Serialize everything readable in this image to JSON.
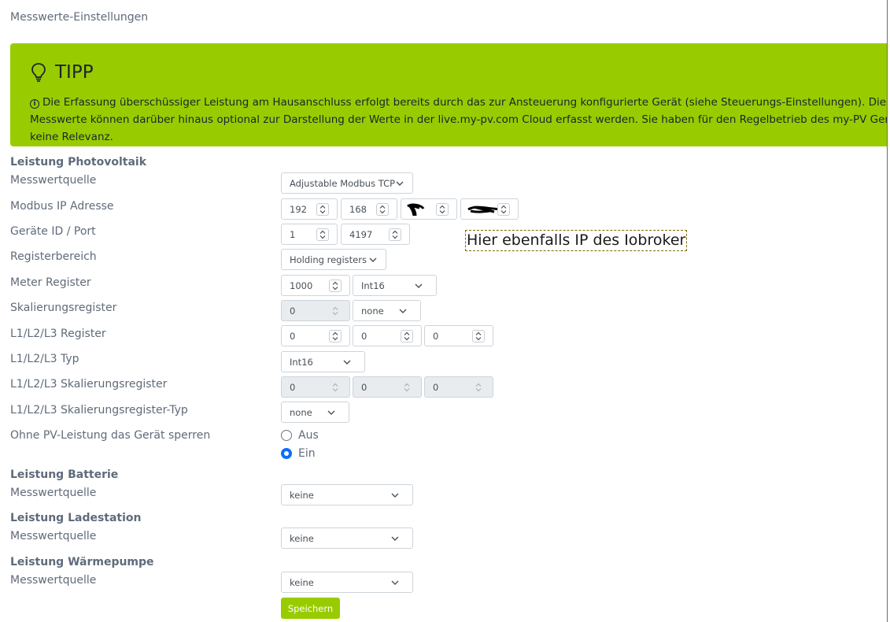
{
  "page": {
    "title": "Messwerte-Einstellungen"
  },
  "tipp": {
    "title": "TIPP",
    "text": "Die Erfassung überschüssiger Leistung am Hausanschluss erfolgt bereits durch das zur Ansteuerung konfigurierte Gerät (siehe Steuerungs-Einstellungen). Diese Messwerte können darüber hinaus optional zur Darstellung der Werte in der live.my-pv.com Cloud erfasst werden. Sie haben für den Regelbetrieb des my-PV Geräts keine Relevanz."
  },
  "pv": {
    "section": "Leistung Photovoltaik",
    "source_label": "Messwertquelle",
    "source_value": "Adjustable Modbus TCP",
    "ip_label": "Modbus IP Adresse",
    "ip": [
      "192",
      "168",
      "",
      ""
    ],
    "id_port_label": "Geräte ID / Port",
    "device_id": "1",
    "port": "4197",
    "register_area_label": "Registerbereich",
    "register_area_value": "Holding registers",
    "meter_register_label": "Meter Register",
    "meter_register_value": "1000",
    "meter_register_type": "Int16",
    "scaling_register_label": "Skalierungsregister",
    "scaling_register_value": "0",
    "scaling_register_type": "none",
    "phase_register_label": "L1/L2/L3 Register",
    "phase_registers": [
      "0",
      "0",
      "0"
    ],
    "phase_type_label": "L1/L2/L3 Typ",
    "phase_type_value": "Int16",
    "phase_scaling_label": "L1/L2/L3 Skalierungsregister",
    "phase_scaling": [
      "0",
      "0",
      "0"
    ],
    "phase_scaling_type_label": "L1/L2/L3 Skalierungsregister-Typ",
    "phase_scaling_type_value": "none",
    "lock_label": "Ohne PV-Leistung das Gerät sperren",
    "lock_off": "Aus",
    "lock_on": "Ein",
    "lock_selected": "Ein"
  },
  "annotation": {
    "text": "Hier ebenfalls IP des Iobroker"
  },
  "battery": {
    "section": "Leistung Batterie",
    "source_label": "Messwertquelle",
    "source_value": "keine"
  },
  "charger": {
    "section": "Leistung Ladestation",
    "source_label": "Messwertquelle",
    "source_value": "keine"
  },
  "heatpump": {
    "section": "Leistung Wärmepumpe",
    "source_label": "Messwertquelle",
    "source_value": "keine"
  },
  "actions": {
    "save_label": "Speichern"
  },
  "colors": {
    "accent": "#99cc00",
    "radio": "#0d6efd",
    "text": "#5f6b7a"
  },
  "icons": {
    "tipp": "lightbulb-icon",
    "info": "info-circle-icon",
    "select": "chevron-down-icon",
    "spinner": "spinner-arrows-icon"
  }
}
